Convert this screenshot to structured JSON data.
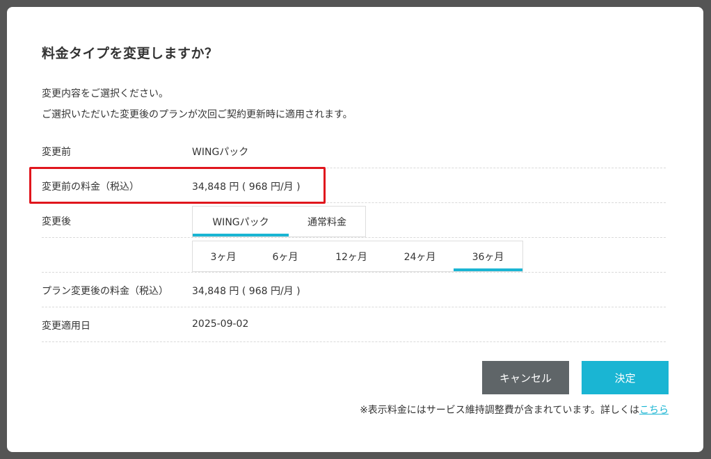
{
  "dialog": {
    "title": "料金タイプを変更しますか？",
    "description_1": "変更内容をご選択ください。",
    "description_2": "ご選択いただいた変更後のプランが次回ご契約更新時に適用されます。"
  },
  "rows": {
    "before_plan": {
      "label": "変更前",
      "value": "WINGパック"
    },
    "before_price": {
      "label": "変更前の料金（税込）",
      "value": "34,848 円 ( 968 円/月 )"
    },
    "after_plan": {
      "label": "変更後"
    },
    "after_price": {
      "label": "プラン変更後の料金（税込）",
      "value": "34,848 円 ( 968 円/月 )"
    },
    "apply_date": {
      "label": "変更適用日",
      "value": "2025-09-02"
    }
  },
  "plan_type_tabs": [
    {
      "label": "WINGパック",
      "selected": true
    },
    {
      "label": "通常料金",
      "selected": false
    }
  ],
  "term_tabs": [
    {
      "label": "3ヶ月",
      "selected": false
    },
    {
      "label": "6ヶ月",
      "selected": false
    },
    {
      "label": "12ヶ月",
      "selected": false
    },
    {
      "label": "24ヶ月",
      "selected": false
    },
    {
      "label": "36ヶ月",
      "selected": true
    }
  ],
  "buttons": {
    "cancel": "キャンセル",
    "confirm": "決定"
  },
  "footer": {
    "note": "※表示料金にはサービス維持調整費が含まれています。詳しくは",
    "link": "こちら"
  },
  "colors": {
    "accent": "#1ab5d3",
    "cancel_button": "#5f6568",
    "highlight_border": "#e0161d",
    "overlay": "#555555"
  }
}
